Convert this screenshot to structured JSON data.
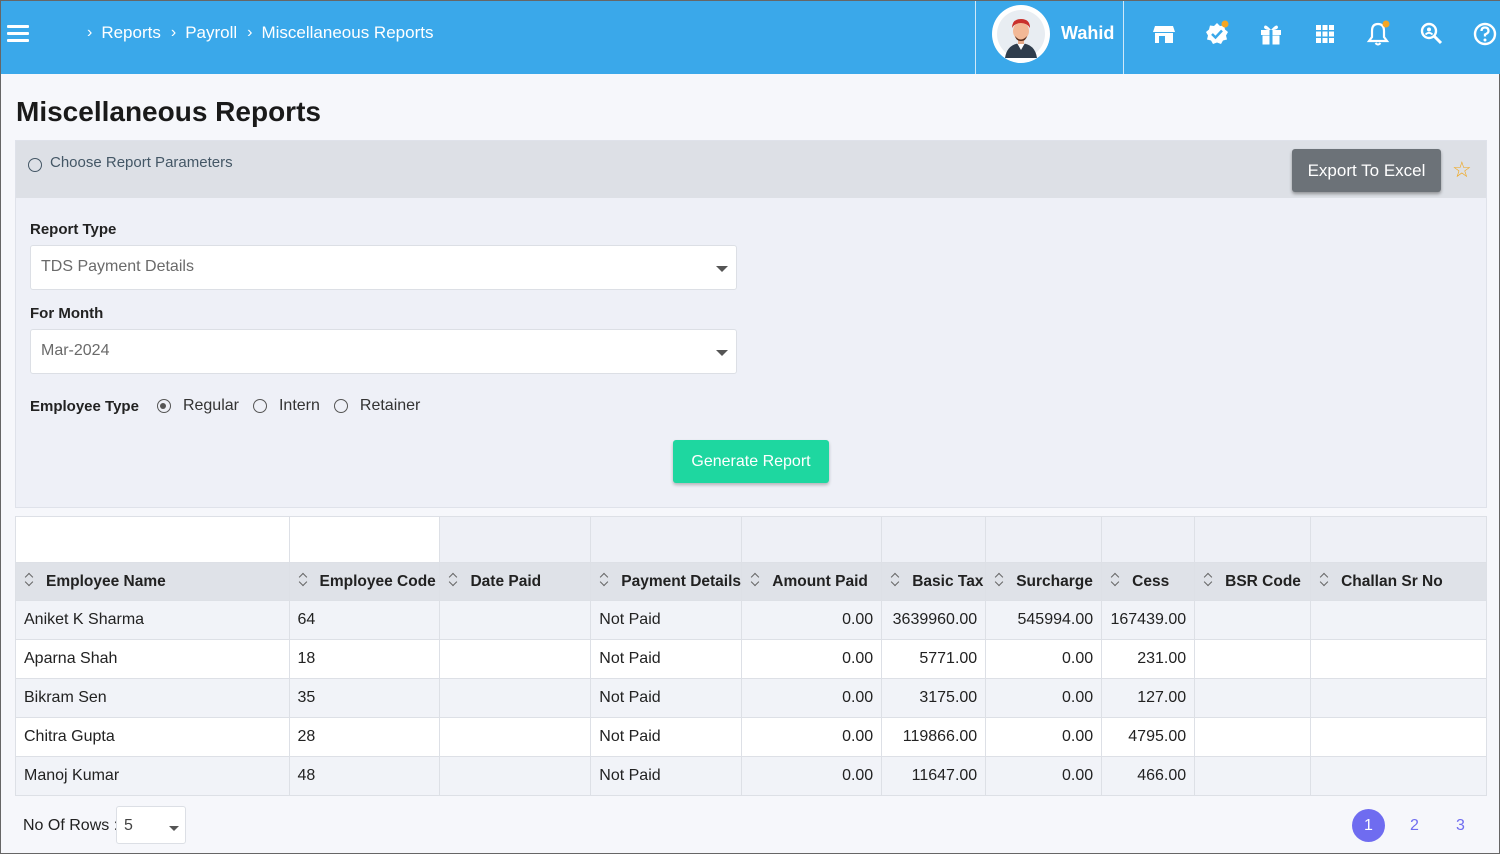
{
  "breadcrumb": [
    "Reports",
    "Payroll",
    "Miscellaneous Reports"
  ],
  "user": {
    "name": "Wahid"
  },
  "top_icons": [
    "store-icon",
    "verified-check-icon",
    "gift-icon",
    "apps-grid-icon",
    "bell-icon",
    "search-person-icon",
    "help-icon"
  ],
  "colors": {
    "topbar": "#3aa8ea",
    "generate": "#1ed7a0",
    "export": "#6c7278",
    "star": "#f0a71f",
    "pager": "#6f6cf0"
  },
  "page_title": "Miscellaneous Reports",
  "params": {
    "header": "Choose Report Parameters",
    "export_label": "Export To Excel",
    "report_type_label": "Report Type",
    "report_type_value": "TDS Payment Details",
    "month_label": "For Month",
    "month_value": "Mar-2024",
    "employee_type_label": "Employee Type",
    "employee_types": [
      "Regular",
      "Intern",
      "Retainer"
    ],
    "employee_type_selected": "Regular",
    "generate_label": "Generate Report"
  },
  "table": {
    "columns": [
      "Employee Name",
      "Employee Code",
      "Date Paid",
      "Payment Details",
      "Amount Paid",
      "Basic Tax",
      "Surcharge",
      "Cess",
      "BSR Code",
      "Challan Sr No"
    ],
    "rows": [
      [
        "Aniket K Sharma",
        "64",
        "",
        "Not Paid",
        "0.00",
        "3639960.00",
        "545994.00",
        "167439.00",
        "",
        ""
      ],
      [
        "Aparna Shah",
        "18",
        "",
        "Not Paid",
        "0.00",
        "5771.00",
        "0.00",
        "231.00",
        "",
        ""
      ],
      [
        "Bikram Sen",
        "35",
        "",
        "Not Paid",
        "0.00",
        "3175.00",
        "0.00",
        "127.00",
        "",
        ""
      ],
      [
        "Chitra Gupta",
        "28",
        "",
        "Not Paid",
        "0.00",
        "119866.00",
        "0.00",
        "4795.00",
        "",
        ""
      ],
      [
        "Manoj Kumar",
        "48",
        "",
        "Not Paid",
        "0.00",
        "11647.00",
        "0.00",
        "466.00",
        "",
        ""
      ]
    ]
  },
  "footer": {
    "rows_label": "No Of Rows :",
    "rows_value": "5",
    "pages": [
      "1",
      "2",
      "3"
    ],
    "active_page": "1"
  }
}
